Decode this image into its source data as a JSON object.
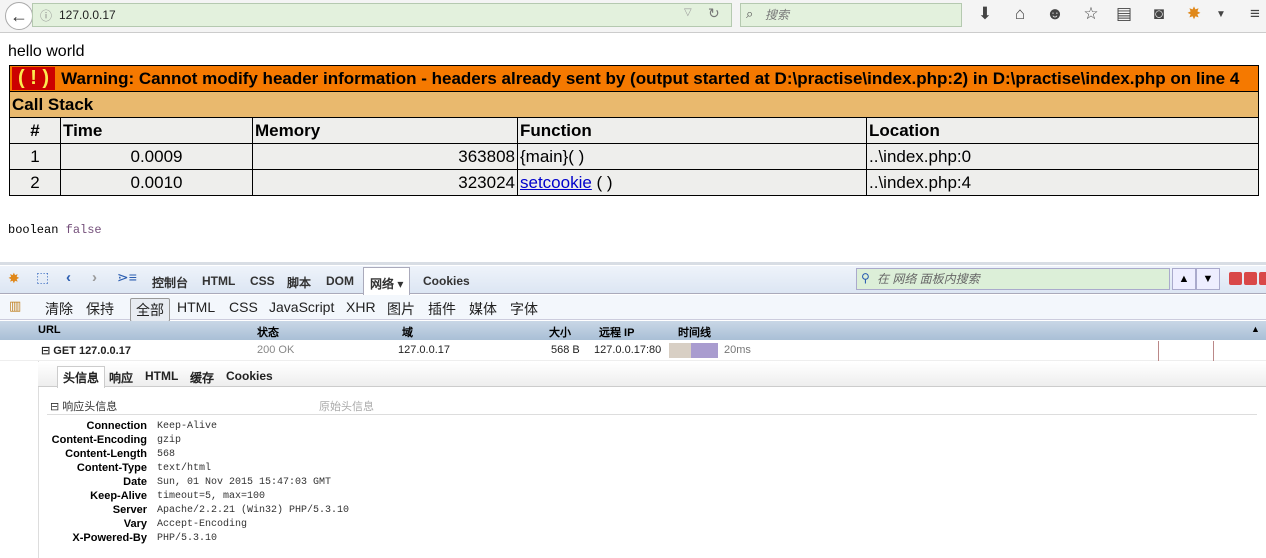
{
  "browser": {
    "url": "127.0.0.17",
    "search_placeholder": "搜索"
  },
  "page": {
    "hello": "hello world",
    "warning": {
      "icon": "( ! )",
      "text": "Warning: Cannot modify header information - headers already sent by (output started at D:\\practise\\index.php:2) in D:\\practise\\index.php on line 4"
    },
    "call_stack": "Call Stack",
    "headers": [
      "#",
      "Time",
      "Memory",
      "Function",
      "Location"
    ],
    "rows": [
      {
        "n": "1",
        "time": "0.0009",
        "memory": "363808",
        "func": "{main}( )",
        "func_link": "",
        "func_rest": "",
        "location": "..\\index.php:0"
      },
      {
        "n": "2",
        "time": "0.0010",
        "memory": "323024",
        "func": "",
        "func_link": "setcookie",
        "func_rest": " ( )",
        "location": "..\\index.php:4"
      }
    ],
    "dump_type": "boolean",
    "dump_value": "false"
  },
  "firebug": {
    "tabs": [
      "控制台",
      "HTML",
      "CSS",
      "脚本",
      "DOM",
      "网络 ▾",
      "Cookies"
    ],
    "active_tab": "网络 ▾",
    "search_placeholder": "在 网络 面板内搜索",
    "filters": [
      "清除",
      "保持",
      "全部",
      "HTML",
      "CSS",
      "JavaScript",
      "XHR",
      "图片",
      "插件",
      "媒体",
      "字体"
    ],
    "columns": {
      "url": "URL",
      "status": "状态",
      "domain": "域",
      "size": "大小",
      "ip": "远程 IP",
      "timeline": "时间线"
    },
    "request": {
      "url": "GET 127.0.0.17",
      "status": "200 OK",
      "domain": "127.0.0.17",
      "size": "568 B",
      "ip": "127.0.0.17:80",
      "time": "20ms"
    },
    "detail_tabs": [
      "头信息",
      "响应",
      "HTML",
      "缓存",
      "Cookies"
    ],
    "section": "响应头信息",
    "raw": "原始头信息",
    "response_headers": [
      {
        "name": "Connection",
        "value": "Keep-Alive"
      },
      {
        "name": "Content-Encoding",
        "value": "gzip"
      },
      {
        "name": "Content-Length",
        "value": "568"
      },
      {
        "name": "Content-Type",
        "value": "text/html"
      },
      {
        "name": "Date",
        "value": "Sun, 01 Nov 2015 15:47:03 GMT"
      },
      {
        "name": "Keep-Alive",
        "value": "timeout=5, max=100"
      },
      {
        "name": "Server",
        "value": "Apache/2.2.21 (Win32) PHP/5.3.10"
      },
      {
        "name": "Vary",
        "value": "Accept-Encoding"
      },
      {
        "name": "X-Powered-By",
        "value": "PHP/5.3.10"
      }
    ]
  }
}
